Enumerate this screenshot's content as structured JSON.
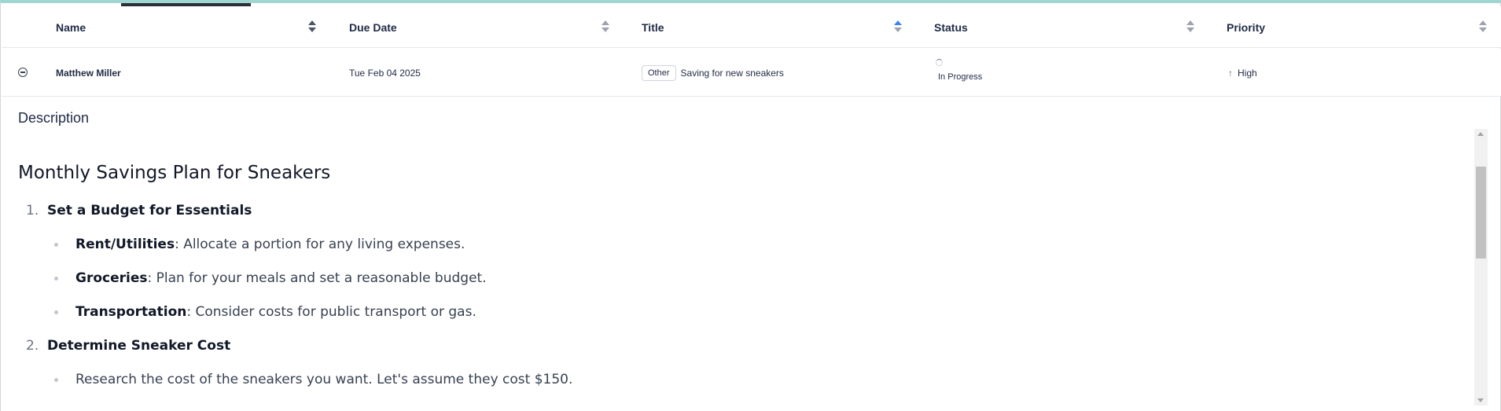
{
  "table": {
    "columns": [
      {
        "label": "Name"
      },
      {
        "label": "Due Date"
      },
      {
        "label": "Title"
      },
      {
        "label": "Status"
      },
      {
        "label": "Priority"
      }
    ],
    "row": {
      "name": "Matthew Miller",
      "due_date": "Tue Feb 04 2025",
      "tag": "Other",
      "title": "Saving for new sneakers",
      "status": "In Progress",
      "priority": "High"
    }
  },
  "description": {
    "heading": "Description",
    "title": "Monthly Savings Plan for Sneakers",
    "items": [
      {
        "num": "1.",
        "label": "Set a Budget for Essentials",
        "subitems": [
          {
            "bold": "Rent/Utilities",
            "text": ": Allocate a portion for any living expenses."
          },
          {
            "bold": "Groceries",
            "text": ": Plan for your meals and set a reasonable budget."
          },
          {
            "bold": "Transportation",
            "text": ": Consider costs for public transport or gas."
          }
        ]
      },
      {
        "num": "2.",
        "label": "Determine Sneaker Cost",
        "subitems": [
          {
            "bold": "",
            "text": "Research the cost of the sneakers you want. Let's assume they cost $150."
          }
        ]
      }
    ]
  },
  "colors": {
    "accent_top": "#9fd6d2",
    "sort_active": "#3b82f6"
  }
}
